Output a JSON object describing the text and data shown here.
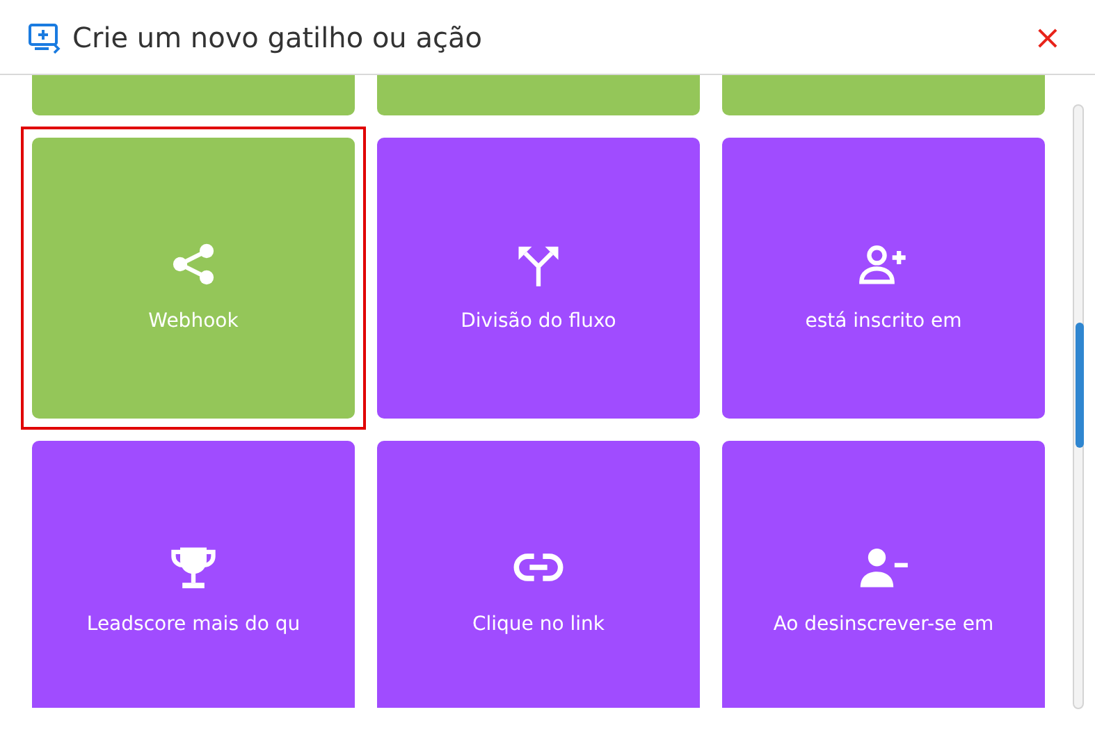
{
  "dialog": {
    "title": "Crie um novo gatilho ou ação",
    "close": "×"
  },
  "cards": [
    {
      "kind": "hidden",
      "color": "#94c659",
      "selected": false
    },
    {
      "kind": "hidden",
      "color": "#94c659",
      "selected": false
    },
    {
      "kind": "hidden",
      "color": "#94c659",
      "selected": false
    },
    {
      "kind": "webhook",
      "label": "Webhook",
      "color": "#94c659",
      "selected": true
    },
    {
      "kind": "split",
      "label": "Divisão do fluxo",
      "color": "#a04cff",
      "selected": false
    },
    {
      "kind": "subscribed",
      "label": "está inscrito em",
      "color": "#a04cff",
      "selected": false
    },
    {
      "kind": "leadscore",
      "label": "Leadscore mais do qu",
      "color": "#a04cff",
      "selected": false
    },
    {
      "kind": "link-click",
      "label": "Clique no link",
      "color": "#a04cff",
      "selected": false
    },
    {
      "kind": "unsubscribe",
      "label": "Ao desinscrever-se em",
      "color": "#a04cff",
      "selected": false
    }
  ]
}
